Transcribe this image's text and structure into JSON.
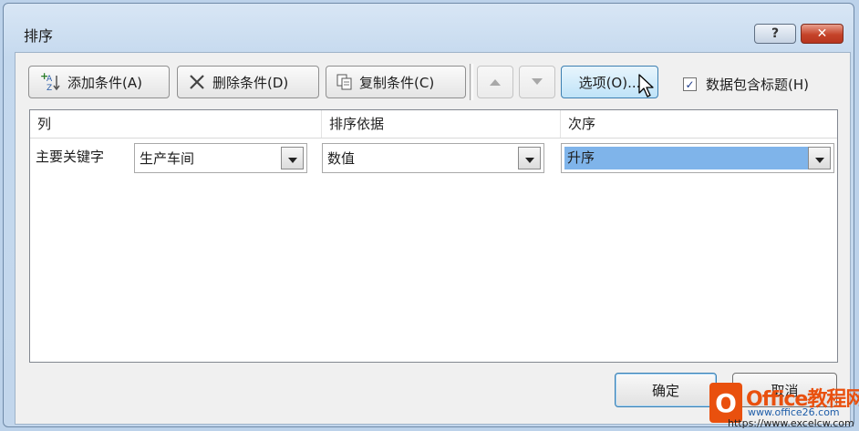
{
  "window": {
    "title": "排序",
    "help_label": "?",
    "close_label": "✕"
  },
  "toolbar": {
    "add_label": "添加条件(A)",
    "delete_label": "删除条件(D)",
    "copy_label": "复制条件(C)",
    "options_label": "选项(O)...",
    "header_checkbox_label": "数据包含标题(H)",
    "header_checkbox_checked": true
  },
  "grid": {
    "headers": [
      "列",
      "排序依据",
      "次序"
    ],
    "rows": [
      {
        "label": "主要关键字",
        "column": "生产车间",
        "sort_on": "数值",
        "order": "升序"
      }
    ]
  },
  "footer": {
    "ok_label": "确定",
    "cancel_label": "取消"
  },
  "watermark": {
    "logo_letter": "O",
    "brand": "Office教程网",
    "url1": "www.office26.com",
    "url2": "https://www.excelcw.com"
  }
}
